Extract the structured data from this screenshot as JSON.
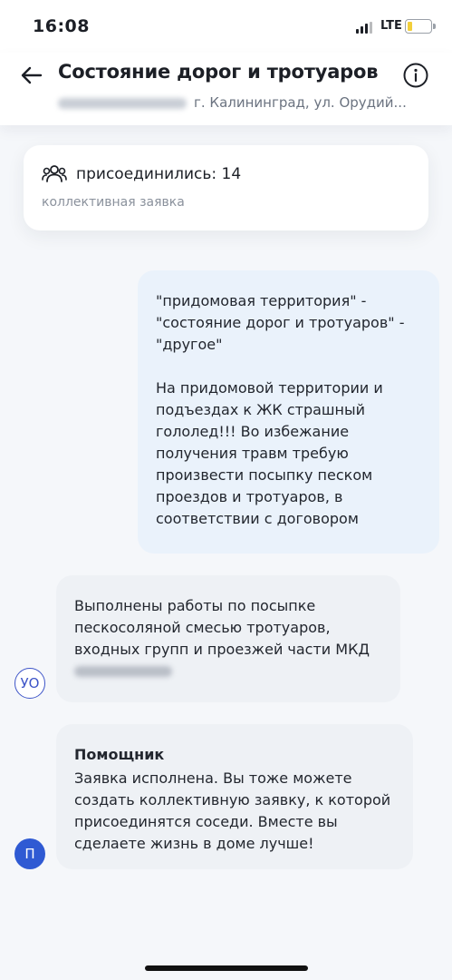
{
  "status_bar": {
    "time": "16:08",
    "network": "LTE"
  },
  "header": {
    "title": "Состояние дорог и тротуаров",
    "address": "г. Калининград, ул. Орудий..."
  },
  "icons": {
    "back": "arrow-left-icon",
    "info": "info-icon",
    "people": "people-group-icon"
  },
  "joined_card": {
    "joined_text": "присоединились: 14",
    "type_label": "коллективная заявка"
  },
  "messages": {
    "user_categories": "\"придомовая территория\" -\n\"состояние дорог и тротуаров\" -\n\"другое\"",
    "user_text": "На придомовой территории и подъездах к ЖК страшный гололед!!! Во избежание получения травм требую произвести посыпку песком проездов и тротуаров, в соответствии с договором",
    "org_text": "Выполнены работы по посыпке пескосоляной смесью  тротуаров, входных групп и проезжей части МКД",
    "org_avatar": "УО",
    "assistant_name": "Помощник",
    "assistant_text": "Заявка исполнена. Вы тоже можете создать коллективную заявку, к которой присоединятся соседи. Вместе вы сделаете жизнь в доме лучше!",
    "assistant_avatar": "П"
  },
  "colors": {
    "accent": "#2f5ad3",
    "user_bubble": "#eaf2fb",
    "other_bubble": "#eef1f5"
  }
}
